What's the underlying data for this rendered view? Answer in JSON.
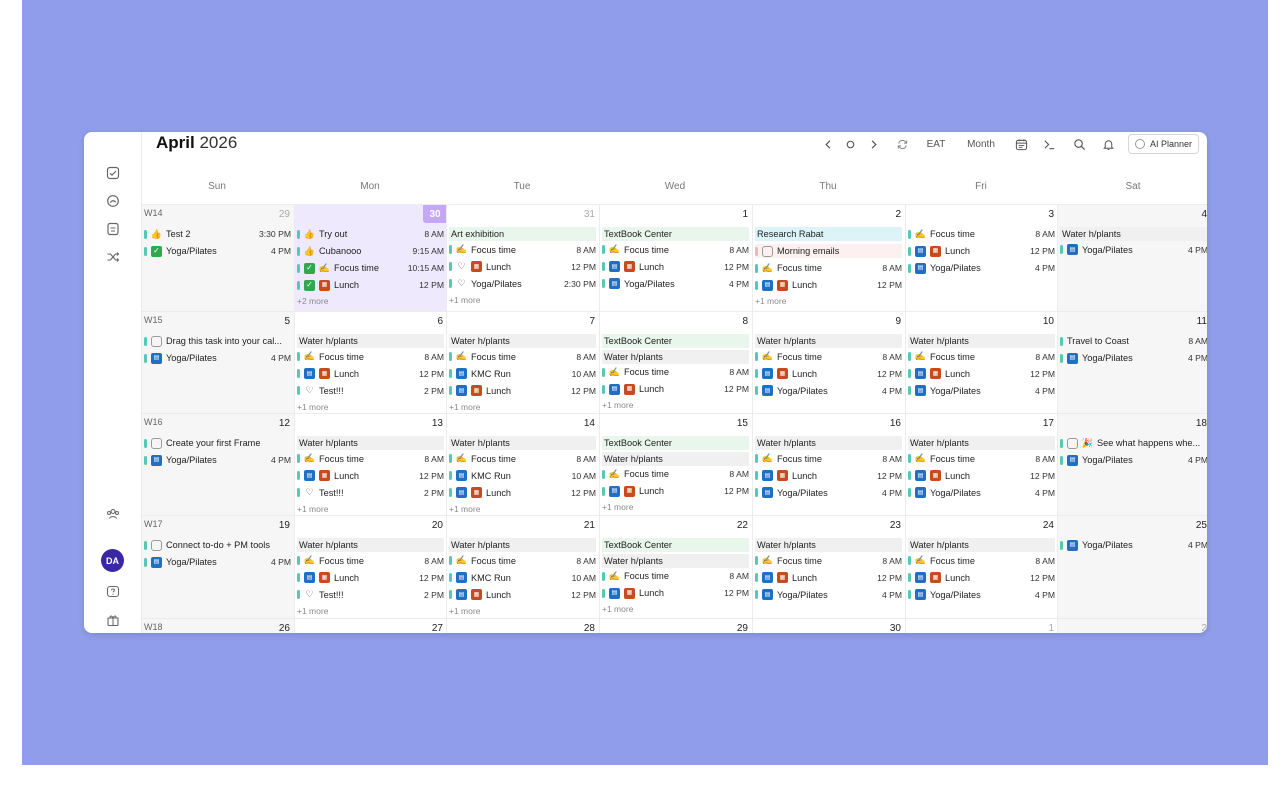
{
  "calendar": {
    "month": "April",
    "year": "2026",
    "timezone": "EAT",
    "view": "Month",
    "ai_planner": "AI Planner",
    "avatar": "DA",
    "accent_color": "#c4a7f5",
    "backdrop_color": "#8f9dea"
  },
  "weekdays": [
    "Sun",
    "Mon",
    "Tue",
    "Wed",
    "Thu",
    "Fri",
    "Sat"
  ],
  "weeks": [
    {
      "label": "W14",
      "days": [
        {
          "num": "29",
          "muted": true,
          "events": [
            {
              "t": "Test 2",
              "time": "3:30 PM",
              "icon": "thumbs-up-icon"
            },
            {
              "t": "Yoga/Pilates",
              "time": "4 PM",
              "icon": "checked-box-icon"
            }
          ]
        },
        {
          "num": "30",
          "today": true,
          "events": [
            {
              "t": "Try out",
              "time": "8 AM",
              "icon": "thumbs-up-icon"
            },
            {
              "t": "Cubanooo",
              "time": "9:15 AM",
              "icon": "thumbs-up-icon"
            },
            {
              "t": "Focus time",
              "time": "10:15 AM",
              "icon": "checked-box-icon",
              "icon2": "writing-hand-icon"
            },
            {
              "t": "Lunch",
              "time": "12 PM",
              "icon": "checked-box-icon",
              "icon2": "lunch-icon"
            }
          ],
          "more": "+2 more"
        },
        {
          "num": "31",
          "muted": true,
          "events": [
            {
              "t": "Art exhibition",
              "allday": true,
              "style": "green"
            },
            {
              "t": "Focus time",
              "time": "8 AM",
              "icon": "writing-hand-icon"
            },
            {
              "t": "Lunch",
              "time": "12 PM",
              "icon": "heart-icon",
              "icon2": "lunch-icon"
            },
            {
              "t": "Yoga/Pilates",
              "time": "2:30 PM",
              "icon": "heart-icon"
            }
          ],
          "more": "+1 more"
        },
        {
          "num": "1",
          "events": [
            {
              "t": "TextBook Center",
              "allday": true,
              "style": "green"
            },
            {
              "t": "Focus time",
              "time": "8 AM",
              "icon": "writing-hand-icon"
            },
            {
              "t": "Lunch",
              "time": "12 PM",
              "icon": "calendar-app-icon",
              "icon2": "lunch-icon"
            },
            {
              "t": "Yoga/Pilates",
              "time": "4 PM",
              "icon": "calendar-app-icon"
            }
          ]
        },
        {
          "num": "2",
          "events": [
            {
              "t": "Research Rabat",
              "allday": true,
              "style": "cyan"
            },
            {
              "t": "Morning emails",
              "icon": "unchecked-box-icon",
              "style": "pink"
            },
            {
              "t": "Focus time",
              "time": "8 AM",
              "icon": "writing-hand-icon"
            },
            {
              "t": "Lunch",
              "time": "12 PM",
              "icon": "calendar-app-icon",
              "icon2": "lunch-icon"
            }
          ],
          "more": "+1 more"
        },
        {
          "num": "3",
          "events": [
            {
              "t": "Focus time",
              "time": "8 AM",
              "icon": "writing-hand-icon"
            },
            {
              "t": "Lunch",
              "time": "12 PM",
              "icon": "calendar-app-icon",
              "icon2": "lunch-icon"
            },
            {
              "t": "Yoga/Pilates",
              "time": "4 PM",
              "icon": "calendar-app-icon"
            }
          ]
        },
        {
          "num": "4",
          "events": [
            {
              "t": "Water h/plants",
              "allday": true
            },
            {
              "t": "Yoga/Pilates",
              "time": "4 PM",
              "icon": "calendar-app-icon"
            }
          ]
        }
      ]
    },
    {
      "label": "W15",
      "days": [
        {
          "num": "5",
          "events": [
            {
              "t": "Drag this task into your cal...",
              "icon": "unchecked-box-icon"
            },
            {
              "t": "Yoga/Pilates",
              "time": "4 PM",
              "icon": "calendar-app-icon"
            }
          ]
        },
        {
          "num": "6",
          "events": [
            {
              "t": "Water h/plants",
              "allday": true
            },
            {
              "t": "Focus time",
              "time": "8 AM",
              "icon": "writing-hand-icon"
            },
            {
              "t": "Lunch",
              "time": "12 PM",
              "icon": "calendar-app-icon",
              "icon2": "lunch-icon"
            },
            {
              "t": "Test!!!",
              "time": "2 PM",
              "icon": "heart-icon"
            }
          ],
          "more": "+1 more"
        },
        {
          "num": "7",
          "events": [
            {
              "t": "Water h/plants",
              "allday": true
            },
            {
              "t": "Focus time",
              "time": "8 AM",
              "icon": "writing-hand-icon"
            },
            {
              "t": "KMC Run",
              "time": "10 AM",
              "icon": "calendar-app-icon"
            },
            {
              "t": "Lunch",
              "time": "12 PM",
              "icon": "calendar-app-icon",
              "icon2": "lunch-icon"
            }
          ],
          "more": "+1 more"
        },
        {
          "num": "8",
          "events": [
            {
              "t": "TextBook Center",
              "allday": true,
              "style": "green"
            },
            {
              "t": "Water h/plants",
              "allday": true
            },
            {
              "t": "Focus time",
              "time": "8 AM",
              "icon": "writing-hand-icon"
            },
            {
              "t": "Lunch",
              "time": "12 PM",
              "icon": "calendar-app-icon",
              "icon2": "lunch-icon"
            }
          ],
          "more": "+1 more"
        },
        {
          "num": "9",
          "events": [
            {
              "t": "Water h/plants",
              "allday": true
            },
            {
              "t": "Focus time",
              "time": "8 AM",
              "icon": "writing-hand-icon"
            },
            {
              "t": "Lunch",
              "time": "12 PM",
              "icon": "calendar-app-icon",
              "icon2": "lunch-icon"
            },
            {
              "t": "Yoga/Pilates",
              "time": "4 PM",
              "icon": "calendar-app-icon"
            }
          ]
        },
        {
          "num": "10",
          "events": [
            {
              "t": "Water h/plants",
              "allday": true
            },
            {
              "t": "Focus time",
              "time": "8 AM",
              "icon": "writing-hand-icon"
            },
            {
              "t": "Lunch",
              "time": "12 PM",
              "icon": "calendar-app-icon",
              "icon2": "lunch-icon"
            },
            {
              "t": "Yoga/Pilates",
              "time": "4 PM",
              "icon": "calendar-app-icon"
            }
          ]
        },
        {
          "num": "11",
          "events": [
            {
              "t": "Travel to Coast",
              "time": "8 AM"
            },
            {
              "t": "Yoga/Pilates",
              "time": "4 PM",
              "icon": "calendar-app-icon"
            }
          ]
        }
      ]
    },
    {
      "label": "W16",
      "days": [
        {
          "num": "12",
          "events": [
            {
              "t": "Create your first Frame",
              "icon": "unchecked-box-icon"
            },
            {
              "t": "Yoga/Pilates",
              "time": "4 PM",
              "icon": "calendar-app-icon"
            }
          ]
        },
        {
          "num": "13",
          "events": [
            {
              "t": "Water h/plants",
              "allday": true
            },
            {
              "t": "Focus time",
              "time": "8 AM",
              "icon": "writing-hand-icon"
            },
            {
              "t": "Lunch",
              "time": "12 PM",
              "icon": "calendar-app-icon",
              "icon2": "lunch-icon"
            },
            {
              "t": "Test!!!",
              "time": "2 PM",
              "icon": "heart-icon"
            }
          ],
          "more": "+1 more"
        },
        {
          "num": "14",
          "events": [
            {
              "t": "Water h/plants",
              "allday": true
            },
            {
              "t": "Focus time",
              "time": "8 AM",
              "icon": "writing-hand-icon"
            },
            {
              "t": "KMC Run",
              "time": "10 AM",
              "icon": "calendar-app-icon"
            },
            {
              "t": "Lunch",
              "time": "12 PM",
              "icon": "calendar-app-icon",
              "icon2": "lunch-icon"
            }
          ],
          "more": "+1 more"
        },
        {
          "num": "15",
          "events": [
            {
              "t": "TextBook Center",
              "allday": true,
              "style": "green"
            },
            {
              "t": "Water h/plants",
              "allday": true
            },
            {
              "t": "Focus time",
              "time": "8 AM",
              "icon": "writing-hand-icon"
            },
            {
              "t": "Lunch",
              "time": "12 PM",
              "icon": "calendar-app-icon",
              "icon2": "lunch-icon"
            }
          ],
          "more": "+1 more"
        },
        {
          "num": "16",
          "events": [
            {
              "t": "Water h/plants",
              "allday": true
            },
            {
              "t": "Focus time",
              "time": "8 AM",
              "icon": "writing-hand-icon"
            },
            {
              "t": "Lunch",
              "time": "12 PM",
              "icon": "calendar-app-icon",
              "icon2": "lunch-icon"
            },
            {
              "t": "Yoga/Pilates",
              "time": "4 PM",
              "icon": "calendar-app-icon"
            }
          ]
        },
        {
          "num": "17",
          "events": [
            {
              "t": "Water h/plants",
              "allday": true
            },
            {
              "t": "Focus time",
              "time": "8 AM",
              "icon": "writing-hand-icon"
            },
            {
              "t": "Lunch",
              "time": "12 PM",
              "icon": "calendar-app-icon",
              "icon2": "lunch-icon"
            },
            {
              "t": "Yoga/Pilates",
              "time": "4 PM",
              "icon": "calendar-app-icon"
            }
          ]
        },
        {
          "num": "18",
          "events": [
            {
              "t": "See what happens whe...",
              "icon": "unchecked-box-icon",
              "icon2": "party-popper-icon"
            },
            {
              "t": "Yoga/Pilates",
              "time": "4 PM",
              "icon": "calendar-app-icon"
            }
          ]
        }
      ]
    },
    {
      "label": "W17",
      "days": [
        {
          "num": "19",
          "events": [
            {
              "t": "Connect to-do + PM tools",
              "icon": "unchecked-box-icon"
            },
            {
              "t": "Yoga/Pilates",
              "time": "4 PM",
              "icon": "calendar-app-icon"
            }
          ]
        },
        {
          "num": "20",
          "events": [
            {
              "t": "Water h/plants",
              "allday": true
            },
            {
              "t": "Focus time",
              "time": "8 AM",
              "icon": "writing-hand-icon"
            },
            {
              "t": "Lunch",
              "time": "12 PM",
              "icon": "calendar-app-icon",
              "icon2": "lunch-icon"
            },
            {
              "t": "Test!!!",
              "time": "2 PM",
              "icon": "heart-icon"
            }
          ],
          "more": "+1 more"
        },
        {
          "num": "21",
          "events": [
            {
              "t": "Water h/plants",
              "allday": true
            },
            {
              "t": "Focus time",
              "time": "8 AM",
              "icon": "writing-hand-icon"
            },
            {
              "t": "KMC Run",
              "time": "10 AM",
              "icon": "calendar-app-icon"
            },
            {
              "t": "Lunch",
              "time": "12 PM",
              "icon": "calendar-app-icon",
              "icon2": "lunch-icon"
            }
          ],
          "more": "+1 more"
        },
        {
          "num": "22",
          "events": [
            {
              "t": "TextBook Center",
              "allday": true,
              "style": "green"
            },
            {
              "t": "Water h/plants",
              "allday": true
            },
            {
              "t": "Focus time",
              "time": "8 AM",
              "icon": "writing-hand-icon"
            },
            {
              "t": "Lunch",
              "time": "12 PM",
              "icon": "calendar-app-icon",
              "icon2": "lunch-icon"
            }
          ],
          "more": "+1 more"
        },
        {
          "num": "23",
          "events": [
            {
              "t": "Water h/plants",
              "allday": true
            },
            {
              "t": "Focus time",
              "time": "8 AM",
              "icon": "writing-hand-icon"
            },
            {
              "t": "Lunch",
              "time": "12 PM",
              "icon": "calendar-app-icon",
              "icon2": "lunch-icon"
            },
            {
              "t": "Yoga/Pilates",
              "time": "4 PM",
              "icon": "calendar-app-icon"
            }
          ]
        },
        {
          "num": "24",
          "events": [
            {
              "t": "Water h/plants",
              "allday": true
            },
            {
              "t": "Focus time",
              "time": "8 AM",
              "icon": "writing-hand-icon"
            },
            {
              "t": "Lunch",
              "time": "12 PM",
              "icon": "calendar-app-icon",
              "icon2": "lunch-icon"
            },
            {
              "t": "Yoga/Pilates",
              "time": "4 PM",
              "icon": "calendar-app-icon"
            }
          ]
        },
        {
          "num": "25",
          "events": [
            {
              "t": "Yoga/Pilates",
              "time": "4 PM",
              "icon": "calendar-app-icon"
            }
          ]
        }
      ]
    },
    {
      "label": "W18",
      "days": [
        {
          "num": "26",
          "events": []
        },
        {
          "num": "27",
          "events": []
        },
        {
          "num": "28",
          "events": []
        },
        {
          "num": "29",
          "events": []
        },
        {
          "num": "30",
          "events": []
        },
        {
          "num": "1",
          "muted": true,
          "events": []
        },
        {
          "num": "2",
          "muted": true,
          "events": []
        }
      ]
    }
  ]
}
